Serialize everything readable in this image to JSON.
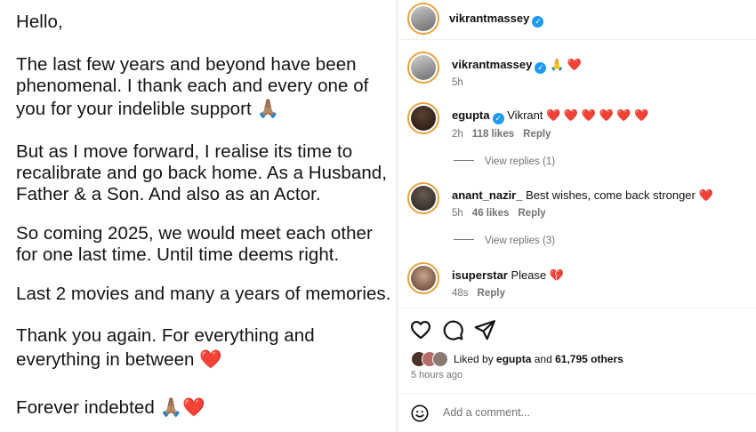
{
  "post_text": {
    "lines": [
      "Hello,",
      "The last few years and beyond have been",
      "phenomenal. I thank each and every one of",
      "you for your indelible support 🙏🏽",
      "But as I move forward, I realise its time to",
      "recalibrate and go back home. As a Husband,",
      "Father & a Son. And also as an Actor.",
      "So coming 2025, we would meet each other",
      "for one last time. Until time deems right.",
      "Last 2 movies and many a years of memories.",
      "Thank you again. For everything and",
      "everything in between ❤️",
      "Forever indebted 🙏🏽❤️"
    ]
  },
  "header": {
    "username": "vikrantmassey"
  },
  "caption": {
    "username": "vikrantmassey",
    "text": "🙏 ❤️",
    "time": "5h"
  },
  "comments": [
    {
      "username": "egupta",
      "verified": true,
      "text": "Vikrant",
      "hearts": "❤️ ❤️ ❤️ ❤️ ❤️ ❤️",
      "time": "2h",
      "likes": "118 likes",
      "reply": "Reply",
      "view_replies": "View replies (1)"
    },
    {
      "username": "anant_nazir_",
      "verified": false,
      "text": "Best wishes, come back stronger",
      "hearts": "❤️",
      "time": "5h",
      "likes": "46 likes",
      "reply": "Reply",
      "view_replies": "View replies (3)"
    },
    {
      "username": "isuperstar",
      "verified": false,
      "text": "Please",
      "hearts": "💔",
      "time": "48s",
      "likes": "",
      "reply": "Reply",
      "view_replies": ""
    }
  ],
  "actions": {
    "like_icon": "heart-outline-icon",
    "comment_icon": "comment-bubble-icon",
    "share_icon": "paper-plane-icon"
  },
  "likes": {
    "prefix": "Liked by",
    "user": "egupta",
    "mid": "and",
    "count": "61,795 others"
  },
  "time_ago": "5 hours ago",
  "comment_input": {
    "placeholder": "Add a comment..."
  },
  "colors": {
    "heart": "#ed1c3a",
    "verified": "#1d9bf0",
    "story_ring": "#e8a23c"
  }
}
